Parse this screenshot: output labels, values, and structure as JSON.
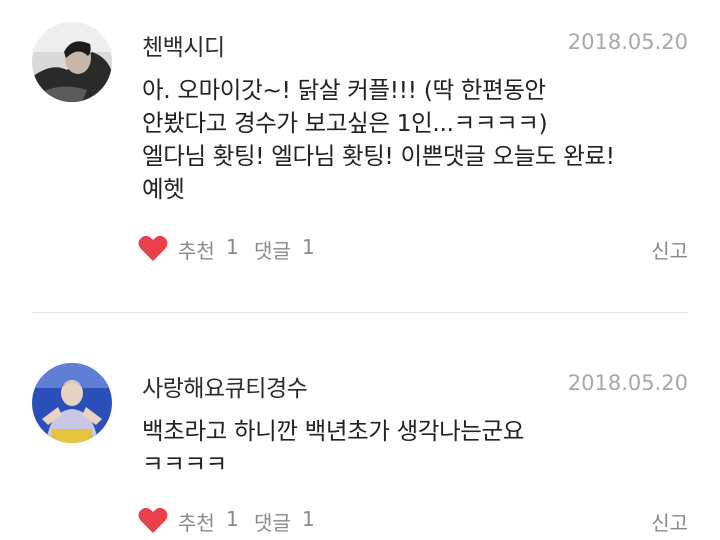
{
  "comments": [
    {
      "author": "첸백시디",
      "date": "2018.05.20",
      "lines": [
        "아. 오마이갓~! 닭살 커플!!! (딱 한편동안",
        "안봤다고 경수가 보고싶은 1인...ㅋㅋㅋㅋ)",
        "엘다님 홧팅! 엘다님 홧팅! 이쁜댓글 오늘도 완료!",
        "예헷"
      ],
      "like_label": "추천",
      "like_count": "1",
      "reply_label": "댓글",
      "reply_count": "1",
      "report_label": "신고",
      "avatar_icon": "user-avatar-dark"
    },
    {
      "author": "사랑해요큐티경수",
      "date": "2018.05.20",
      "lines": [
        "백초라고 하니깐 백년초가 생각나는군요",
        "ㅋㅋㅋㅋ"
      ],
      "like_label": "추천",
      "like_count": "1",
      "reply_label": "댓글",
      "reply_count": "1",
      "report_label": "신고",
      "avatar_icon": "user-avatar-blue"
    }
  ],
  "colors": {
    "heart": "#e8414b",
    "meta": "#8a8a8a",
    "date": "#a8a8a8",
    "text": "#222222"
  }
}
